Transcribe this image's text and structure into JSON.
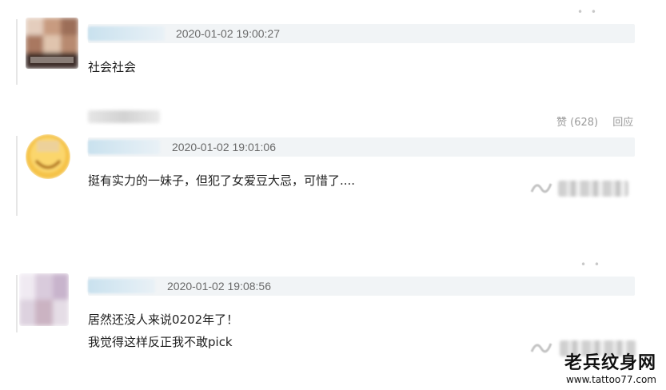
{
  "top_dots": "• •",
  "comments": [
    {
      "timestamp": "2020-01-02 19:00:27",
      "lines": [
        "社会社会"
      ],
      "actions": {
        "like_label": "赞 (628)",
        "reply_label": "回应"
      }
    },
    {
      "timestamp": "2020-01-02 19:01:06",
      "lines": [
        "挺有实力的一妹子，但犯了女爱豆大忌，可惜了...."
      ]
    },
    {
      "timestamp": "2020-01-02 19:08:56",
      "lines": [
        "居然还没人来说0202年了！",
        "我觉得这样反正我不敢pick"
      ],
      "dots": "• •"
    }
  ],
  "watermark": {
    "site_name": "老兵纹身网",
    "site_url": "www.tattoo77.com"
  },
  "colors": {
    "meta_bar": "#f1f4f6",
    "timestamp": "#6a6a6a",
    "text": "#1f1f1f",
    "action": "#9a9a9a"
  }
}
